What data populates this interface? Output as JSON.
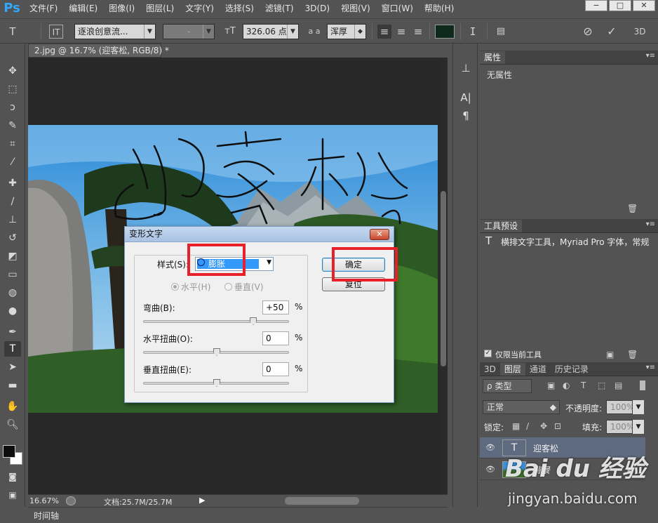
{
  "app": {
    "logo": "Ps",
    "menu": [
      "文件(F)",
      "编辑(E)",
      "图像(I)",
      "图层(L)",
      "文字(Y)",
      "选择(S)",
      "滤镜(T)",
      "3D(D)",
      "视图(V)",
      "窗口(W)",
      "帮助(H)"
    ],
    "window_controls": [
      "−",
      "□",
      "✕"
    ]
  },
  "options_bar": {
    "tool_icon": "type-tool-icon",
    "font_family": "逐浪创意流...",
    "font_style": "-",
    "font_size": "326.06 点",
    "aa_label": "a a",
    "anti_alias": "浑厚",
    "text_color": "#0d2a1c",
    "label_3d": "3D"
  },
  "document": {
    "tab_title": "2.jpg @ 16.7% (迎客松, RGB/8) *",
    "tab_close": "×",
    "artwork_text": "迎客松"
  },
  "status": {
    "zoom": "16.67%",
    "doc_info": "文档:25.7M/25.7M",
    "timeline": "时间轴"
  },
  "dialog": {
    "title": "变形文字",
    "close": "✕",
    "style_label": "样式(S):",
    "style_value": "膨胀",
    "horizontal": "水平(H)",
    "vertical": "垂直(V)",
    "bend_label": "弯曲(B):",
    "bend_value": "+50",
    "bend": 50,
    "h_distort_label": "水平扭曲(O):",
    "h_distort_value": "0",
    "h_distort": 0,
    "v_distort_label": "垂直扭曲(E):",
    "v_distort_value": "0",
    "v_distort": 0,
    "percent": "%",
    "ok": "确定",
    "reset": "复位"
  },
  "panels": {
    "properties": {
      "tab": "属性",
      "empty": "无属性"
    },
    "tool_presets": {
      "tab": "工具预设",
      "item": "横排文字工具，Myriad Pro 字体，常规",
      "current_only": "仅限当前工具"
    },
    "layers": {
      "tabs": [
        "3D",
        "图层",
        "通道",
        "历史记录"
      ],
      "filter_kind": "类型",
      "blend_mode": "正常",
      "opacity_label": "不透明度:",
      "opacity_value": "100%",
      "lock_label": "锁定:",
      "fill_label": "填充:",
      "fill_value": "100%",
      "items": [
        {
          "name": "迎客松",
          "thumb": "T"
        },
        {
          "name": "背景"
        }
      ]
    }
  },
  "watermark": {
    "brand": "Bai du 经验",
    "url": "jingyan.baidu.com"
  },
  "colors": {
    "accent_blue": "#33a8ff",
    "highlight_red": "#e8202a",
    "selection_blue": "#3399ff"
  }
}
